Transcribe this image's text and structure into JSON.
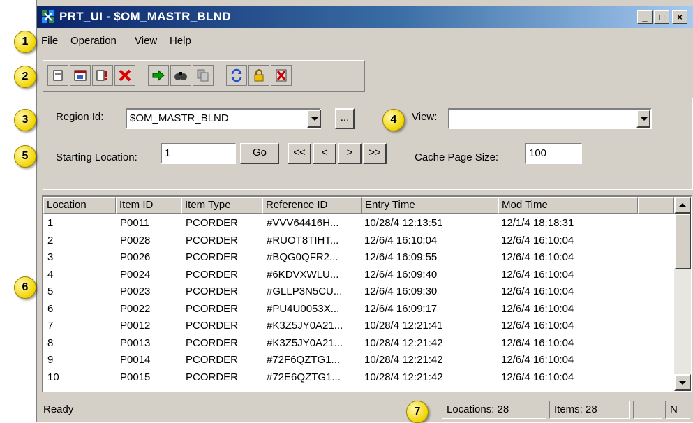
{
  "window": {
    "title": "PRT_UI - $OM_MASTR_BLND"
  },
  "title_buttons": {
    "minimize": "_",
    "maximize": "□",
    "close": "×"
  },
  "menu": [
    "File",
    "Operation",
    "View",
    "Help"
  ],
  "toolbar": {
    "icons": [
      "new-icon",
      "calendar-icon",
      "alert-document-icon",
      "delete-icon",
      "go-arrow-icon",
      "find-icon",
      "copy-icon",
      "refresh-icon",
      "lock-icon",
      "cancel-document-icon"
    ]
  },
  "form": {
    "region_label": "Region Id:",
    "region_value": "$OM_MASTR_BLND",
    "browse_label": "...",
    "view_label": "View:",
    "view_value": "",
    "starting_label": "Starting Location:",
    "starting_value": "1",
    "go_label": "Go",
    "first_label": "<<",
    "prev_label": "<",
    "next_label": ">",
    "last_label": ">>",
    "cache_label": "Cache Page Size:",
    "cache_value": "100"
  },
  "table": {
    "columns": [
      "Location",
      "Item ID",
      "Item Type",
      "Reference ID",
      "Entry Time",
      "Mod Time"
    ],
    "rows": [
      [
        "1",
        "P0011",
        "PCORDER",
        "#VVV64416H...",
        "10/28/4 12:13:51",
        "12/1/4 18:18:31"
      ],
      [
        "2",
        "P0028",
        "PCORDER",
        "#RUOT8TIHT...",
        "12/6/4 16:10:04",
        "12/6/4 16:10:04"
      ],
      [
        "3",
        "P0026",
        "PCORDER",
        "#BQG0QFR2...",
        "12/6/4 16:09:55",
        "12/6/4 16:10:04"
      ],
      [
        "4",
        "P0024",
        "PCORDER",
        "#6KDVXWLU...",
        "12/6/4 16:09:40",
        "12/6/4 16:10:04"
      ],
      [
        "5",
        "P0023",
        "PCORDER",
        "#GLLP3N5CU...",
        "12/6/4 16:09:30",
        "12/6/4 16:10:04"
      ],
      [
        "6",
        "P0022",
        "PCORDER",
        "#PU4U0053X...",
        "12/6/4 16:09:17",
        "12/6/4 16:10:04"
      ],
      [
        "7",
        "P0012",
        "PCORDER",
        "#K3Z5JY0A21...",
        "10/28/4 12:21:41",
        "12/6/4 16:10:04"
      ],
      [
        "8",
        "P0013",
        "PCORDER",
        "#K3Z5JY0A21...",
        "10/28/4 12:21:42",
        "12/6/4 16:10:04"
      ],
      [
        "9",
        "P0014",
        "PCORDER",
        "#72F6QZTG1...",
        "10/28/4 12:21:42",
        "12/6/4 16:10:04"
      ],
      [
        "10",
        "P0015",
        "PCORDER",
        "#72E6QZTG1...",
        "10/28/4 12:21:42",
        "12/6/4 16:10:04"
      ]
    ]
  },
  "status": {
    "text": "Ready",
    "locations": "Locations: 28",
    "items": "Items: 28",
    "mode": "N"
  },
  "callouts": [
    "1",
    "2",
    "3",
    "4",
    "5",
    "6",
    "7"
  ],
  "colors": {
    "titlebar_start": "#0a246a",
    "titlebar_end": "#a6caf0",
    "face": "#d4d0c8",
    "callout": "#f2d400"
  }
}
